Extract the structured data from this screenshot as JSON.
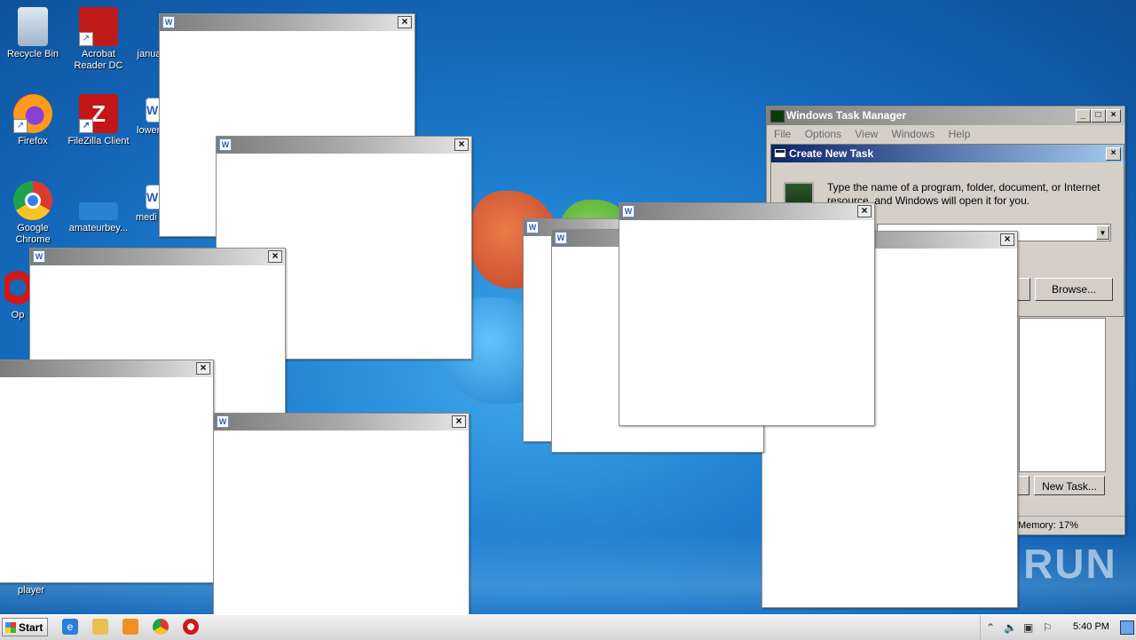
{
  "desktop_icons": [
    {
      "label": "Recycle Bin",
      "icon": "recycle-bin-icon"
    },
    {
      "label": "Acrobat Reader DC",
      "icon": "acrobat-icon"
    },
    {
      "label": "janua",
      "icon": "word-doc-icon"
    },
    {
      "label": "Firefox",
      "icon": "firefox-icon"
    },
    {
      "label": "FileZilla Client",
      "icon": "filezilla-icon"
    },
    {
      "label": "lower",
      "icon": "word-doc-icon"
    },
    {
      "label": "Google Chrome",
      "icon": "chrome-icon"
    },
    {
      "label": "amateurbey...",
      "icon": "file-icon"
    },
    {
      "label": "medi",
      "icon": "word-doc-icon"
    },
    {
      "label": "Op",
      "icon": "opera-icon"
    },
    {
      "label": "player",
      "icon": "file-icon"
    }
  ],
  "word_window": {
    "icon_letter": "W",
    "close_glyph": "×"
  },
  "task_manager": {
    "title": "Windows Task Manager",
    "menu": [
      "File",
      "Options",
      "View",
      "Windows",
      "Help"
    ],
    "new_task_button": "New Task...",
    "status_memory": "Memory: 17%"
  },
  "create_new_task": {
    "title": "Create New Task",
    "description": "Type the name of a program, folder, document, or Internet resource, and Windows will open it for you.",
    "open_value": "",
    "browse_button": "Browse..."
  },
  "taskbar": {
    "start_label": "Start",
    "clock": "5:40 PM"
  },
  "watermark": "ANY RUN"
}
